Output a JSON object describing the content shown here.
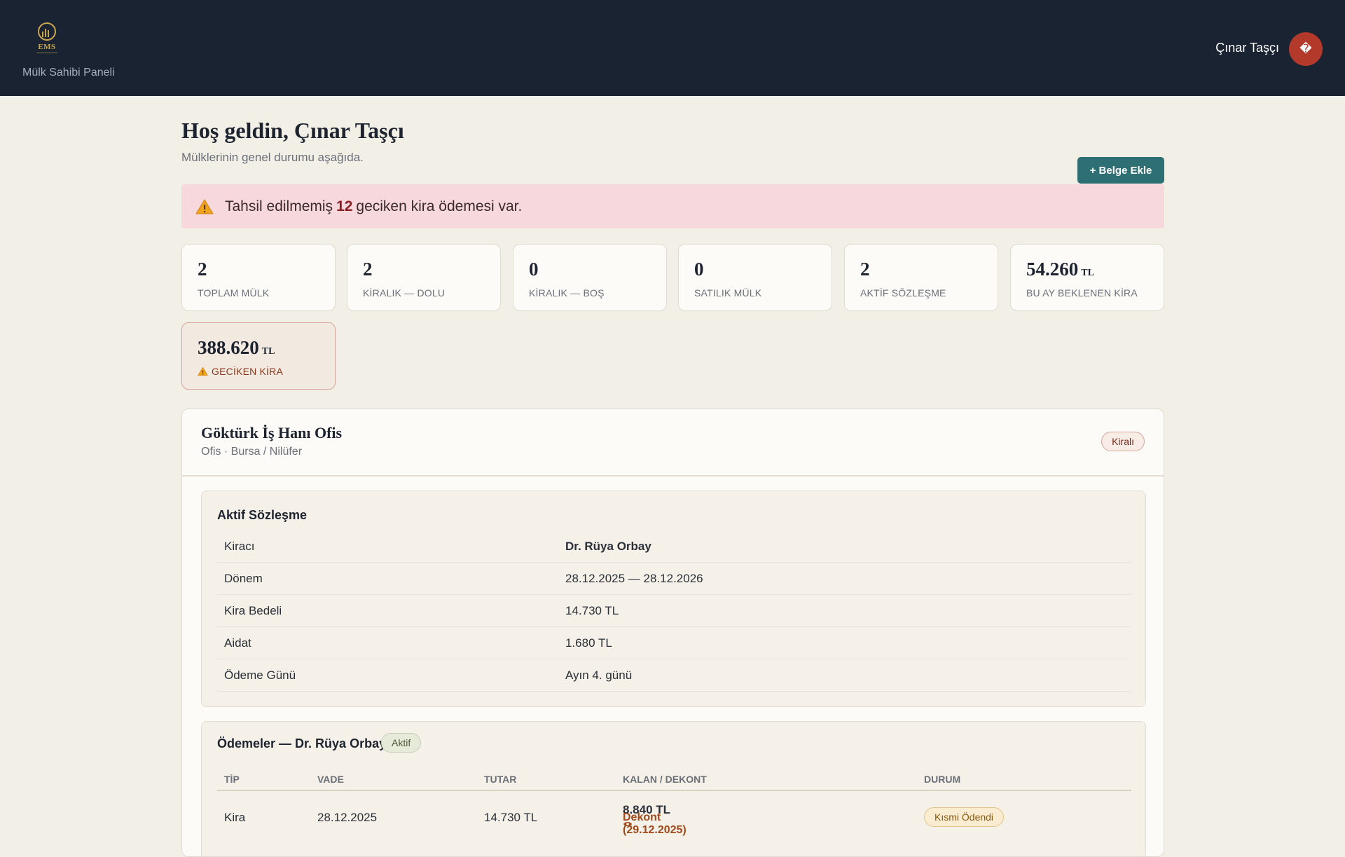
{
  "header": {
    "logo_text": "EMS",
    "panel_label": "Mülk Sahibi Paneli",
    "user_name": "Çınar Taşçı",
    "avatar_glyph": "�",
    "avatar_color": "#b33a2a"
  },
  "page": {
    "title": "Hoş geldin, Çınar Taşçı",
    "subtitle": "Mülklerinin genel durumu aşağıda.",
    "add_document_label": "+ Belge Ekle"
  },
  "alert": {
    "prefix": "Tahsil edilmemiş",
    "count": "12",
    "suffix": "geciken kira ödemesi var.",
    "icon": "warning-icon"
  },
  "stats": [
    {
      "value": "2",
      "label": "TOPLAM MÜLK"
    },
    {
      "value": "2",
      "label": "KİRALIK — DOLU"
    },
    {
      "value": "0",
      "label": "KİRALIK — BOŞ"
    },
    {
      "value": "0",
      "label": "SATILIK MÜLK"
    },
    {
      "value": "2",
      "label": "AKTİF SÖZLEŞME"
    },
    {
      "value": "54.260",
      "unit": "TL",
      "label": "BU AY BEKLENEN KİRA"
    },
    {
      "value": "388.620",
      "unit": "TL",
      "label": "GECİKEN KİRA"
    }
  ],
  "property": {
    "title": "Göktürk İş Hanı Ofis",
    "meta": "Ofis · Bursa / Nilüfer",
    "badge": "Kiralı",
    "contract": {
      "title": "Aktif Sözleşme",
      "rows": [
        {
          "key": "Kiracı",
          "value": "Dr. Rüya Orbay"
        },
        {
          "key": "Dönem",
          "value": "28.12.2025 — 28.12.2026"
        },
        {
          "key": "Kira Bedeli",
          "value": "14.730 TL"
        },
        {
          "key": "Aidat",
          "value": "1.680 TL"
        },
        {
          "key": "Ödeme Günü",
          "value": "Ayın 4. günü"
        }
      ]
    },
    "payments": {
      "title": "Ödemeler — Dr. Rüya Orbay",
      "status": "Aktif",
      "columns": [
        "TİP",
        "VADE",
        "TUTAR",
        "KALAN / DEKONT",
        "DURUM"
      ],
      "rows": [
        {
          "type": "Kira",
          "due": "28.12.2025",
          "amount": "14.730 TL",
          "remaining": "8.840 TL",
          "receipt": "Dekont (29.12.2025)",
          "status": "Kısmi Ödendi"
        }
      ]
    }
  },
  "colors": {
    "topbar": "#1a2332",
    "accent": "#2e6f73",
    "alert_bg": "#f7d8dc",
    "gold": "#c9a54e"
  }
}
